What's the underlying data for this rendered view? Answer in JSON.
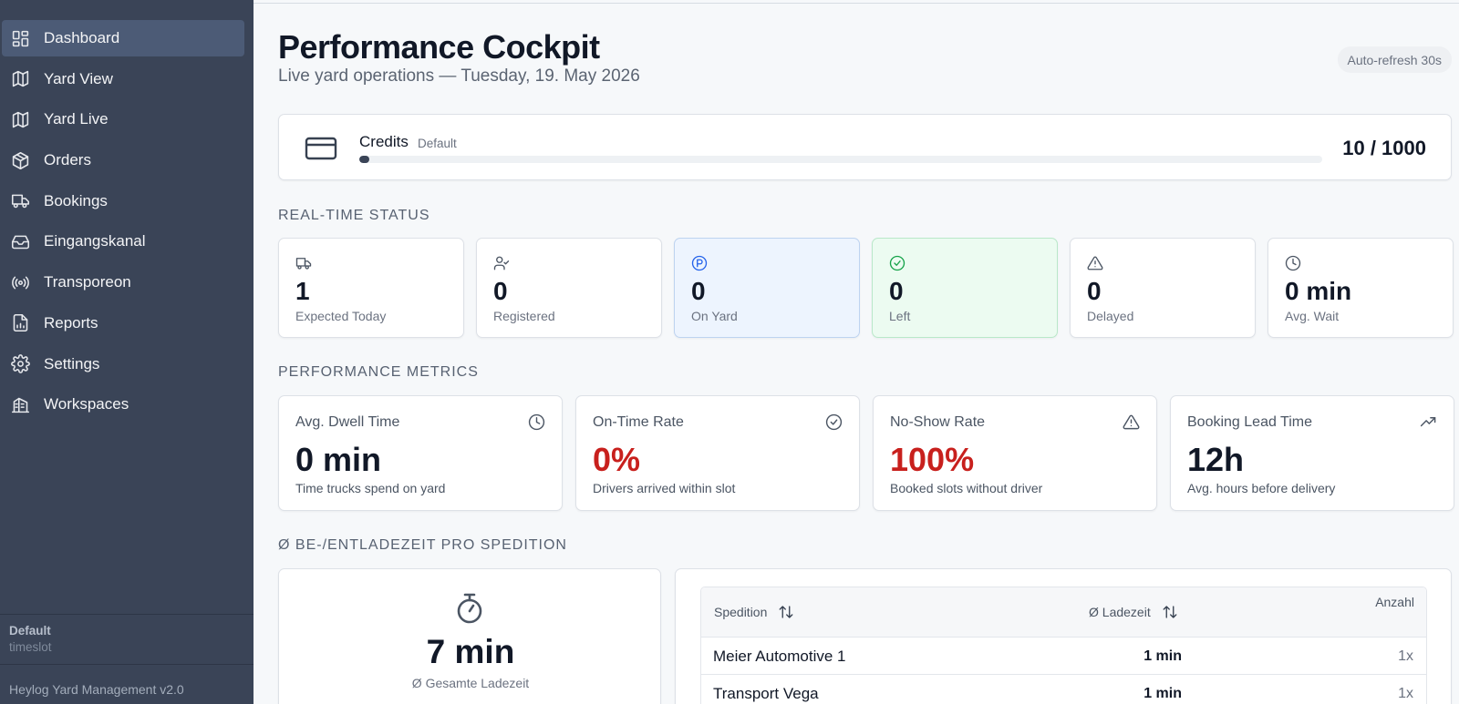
{
  "sidebar": {
    "items": [
      {
        "label": "Dashboard",
        "icon": "dashboard-icon",
        "active": true
      },
      {
        "label": "Yard View",
        "icon": "map-icon"
      },
      {
        "label": "Yard Live",
        "icon": "map-icon"
      },
      {
        "label": "Orders",
        "icon": "package-icon"
      },
      {
        "label": "Bookings",
        "icon": "truck-icon"
      },
      {
        "label": "Eingangskanal",
        "icon": "inbox-icon"
      },
      {
        "label": "Transporeon",
        "icon": "broadcast-icon"
      },
      {
        "label": "Reports",
        "icon": "report-icon"
      },
      {
        "label": "Settings",
        "icon": "gear-icon"
      },
      {
        "label": "Workspaces",
        "icon": "building-icon"
      }
    ],
    "workspace_name": "Default",
    "workspace_sub": "timeslot",
    "version": "Heylog Yard Management v2.0"
  },
  "header": {
    "title": "Performance Cockpit",
    "subtitle": "Live yard operations — Tuesday, 19. May 2026",
    "refresh": "Auto-refresh 30s"
  },
  "credits": {
    "label": "Credits",
    "tier": "Default",
    "value": "10 / 1000",
    "used_fraction": 0.01
  },
  "realtime": {
    "section_label": "REAL-TIME STATUS",
    "stats": [
      {
        "value": "1",
        "label": "Expected Today",
        "icon": "truck-icon"
      },
      {
        "value": "0",
        "label": "Registered",
        "icon": "user-check-icon"
      },
      {
        "value": "0",
        "label": "On Yard",
        "icon": "parking-icon"
      },
      {
        "value": "0",
        "label": "Left",
        "icon": "check-circle-icon"
      },
      {
        "value": "0",
        "label": "Delayed",
        "icon": "warning-icon"
      },
      {
        "value": "0 min",
        "label": "Avg. Wait",
        "icon": "clock-icon"
      }
    ]
  },
  "performance": {
    "section_label": "PERFORMANCE METRICS",
    "metrics": [
      {
        "title": "Avg. Dwell Time",
        "value": "0 min",
        "sub": "Time trucks spend on yard",
        "icon": "clock-icon",
        "color": "#111827"
      },
      {
        "title": "On-Time Rate",
        "value": "0%",
        "sub": "Drivers arrived within slot",
        "icon": "check-circle-icon",
        "color": "#c8201d"
      },
      {
        "title": "No-Show Rate",
        "value": "100%",
        "sub": "Booked slots without driver",
        "icon": "warning-icon",
        "color": "#c8201d"
      },
      {
        "title": "Booking Lead Time",
        "value": "12h",
        "sub": "Avg. hours before delivery",
        "icon": "trending-up-icon",
        "color": "#111827"
      }
    ]
  },
  "loading": {
    "section_label": "Ø BE-/ENTLADEZEIT PRO SPEDITION",
    "summary_value": "7 min",
    "summary_label": "Ø Gesamte Ladezeit",
    "columns": {
      "name": "Spedition",
      "time": "Ø Ladezeit",
      "count": "Anzahl"
    },
    "rows": [
      {
        "name": "Meier Automotive 1",
        "time": "1 min",
        "count": "1x"
      },
      {
        "name": "Transport Vega",
        "time": "1 min",
        "count": "1x"
      }
    ]
  }
}
